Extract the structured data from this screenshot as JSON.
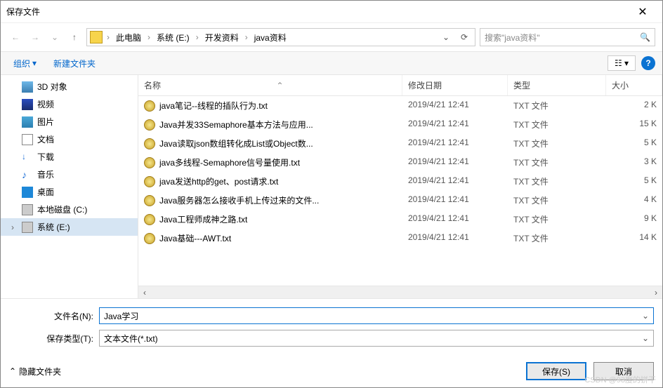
{
  "title": "保存文件",
  "breadcrumb": [
    "此电脑",
    "系统 (E:)",
    "开发资料",
    "java资料"
  ],
  "search_placeholder": "搜索\"java资料\"",
  "toolbar": {
    "organize": "组织",
    "newfolder": "新建文件夹"
  },
  "sidebar": {
    "items": [
      {
        "label": "3D 对象",
        "icon": "ic-3d"
      },
      {
        "label": "视频",
        "icon": "ic-video"
      },
      {
        "label": "图片",
        "icon": "ic-pic"
      },
      {
        "label": "文档",
        "icon": "ic-doc"
      },
      {
        "label": "下载",
        "icon": "ic-dl"
      },
      {
        "label": "音乐",
        "icon": "ic-music"
      },
      {
        "label": "桌面",
        "icon": "ic-desk"
      },
      {
        "label": "本地磁盘 (C:)",
        "icon": "ic-disk"
      },
      {
        "label": "系统 (E:)",
        "icon": "ic-disk",
        "selected": true,
        "expander": "›"
      }
    ]
  },
  "columns": {
    "name": "名称",
    "date": "修改日期",
    "type": "类型",
    "size": "大小"
  },
  "files": [
    {
      "name": "java笔记--线程的插队行为.txt",
      "date": "2019/4/21 12:41",
      "type": "TXT 文件",
      "size": "2 K"
    },
    {
      "name": "Java并发33Semaphore基本方法与应用...",
      "date": "2019/4/21 12:41",
      "type": "TXT 文件",
      "size": "15 K"
    },
    {
      "name": "Java读取json数组转化成List或Object数...",
      "date": "2019/4/21 12:41",
      "type": "TXT 文件",
      "size": "5 K"
    },
    {
      "name": "java多线程-Semaphore信号量使用.txt",
      "date": "2019/4/21 12:41",
      "type": "TXT 文件",
      "size": "3 K"
    },
    {
      "name": "java发送http的get、post请求.txt",
      "date": "2019/4/21 12:41",
      "type": "TXT 文件",
      "size": "5 K"
    },
    {
      "name": "Java服务器怎么接收手机上传过来的文件...",
      "date": "2019/4/21 12:41",
      "type": "TXT 文件",
      "size": "4 K"
    },
    {
      "name": "Java工程师成神之路.txt",
      "date": "2019/4/21 12:41",
      "type": "TXT 文件",
      "size": "9 K"
    },
    {
      "name": "Java基础---AWT.txt",
      "date": "2019/4/21 12:41",
      "type": "TXT 文件",
      "size": "14 K"
    }
  ],
  "fields": {
    "filename_label": "文件名(N):",
    "filename_value": "Java学习",
    "filetype_label": "保存类型(T):",
    "filetype_value": "文本文件(*.txt)"
  },
  "buttons": {
    "hide": "隐藏文件夹",
    "save": "保存(S)",
    "cancel": "取消"
  },
  "watermark": "CSDN @93度的饼干"
}
